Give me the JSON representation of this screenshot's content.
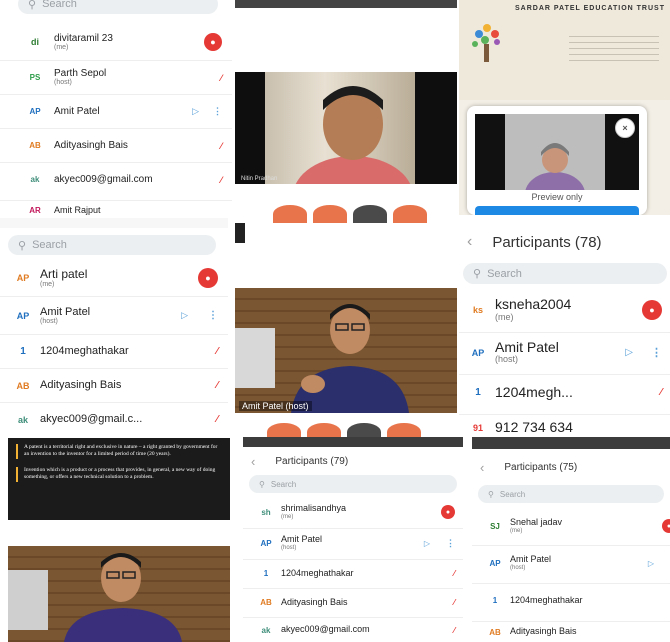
{
  "colors": {
    "accent_red": "#e53935",
    "accent_blue": "#5aa0d8",
    "search_bg": "#eceff1",
    "control_orange": "#e8744b"
  },
  "icons": {
    "search": "search-icon",
    "back": "chevron-left-icon",
    "mic": "mic-icon",
    "camera": "camera-icon",
    "more": "more-icon"
  },
  "t1": {
    "search_placeholder": "Search",
    "rows": [
      {
        "initials": "di",
        "name": "divitaramil 23",
        "sub": "(me)"
      },
      {
        "initials": "PS",
        "name": "Parth Sepol",
        "sub": "(host)"
      },
      {
        "initials": "AP",
        "name": "Amit Patel",
        "sub": ""
      },
      {
        "initials": "AB",
        "name": "Adityasingh Bais",
        "sub": ""
      },
      {
        "initials": "ak",
        "name": "akyec009@gmail.com",
        "sub": ""
      },
      {
        "initials": "AR",
        "name": "Amit Rajput",
        "sub": ""
      }
    ]
  },
  "t2": {
    "video_caption": "Nitin Pradhan"
  },
  "t3": {
    "logo_text": "SARDAR PATEL EDUCATION TRUST",
    "pip_label": "Preview only"
  },
  "t4": {
    "search_placeholder": "Search",
    "rows": [
      {
        "initials": "AP",
        "name": "Arti patel",
        "sub": "(me)"
      },
      {
        "initials": "AP",
        "name": "Amit Patel",
        "sub": "(host)"
      },
      {
        "initials": "1",
        "name": "1204meghathakar",
        "sub": ""
      },
      {
        "initials": "AB",
        "name": "Adityasingh Bais",
        "sub": ""
      },
      {
        "initials": "ak",
        "name": "akyec009@gmail.c...",
        "sub": ""
      }
    ]
  },
  "t5": {
    "video_caption": "Amit Patel (host)"
  },
  "t6": {
    "title": "Participants (78)",
    "search_placeholder": "Search",
    "rows": [
      {
        "initials": "ks",
        "name": "ksneha2004",
        "sub": "(me)"
      },
      {
        "initials": "AP",
        "name": "Amit Patel",
        "sub": "(host)"
      },
      {
        "initials": "1",
        "name": "1204megh...",
        "sub": ""
      },
      {
        "initials": "91",
        "name": "912 734 634",
        "sub": ""
      }
    ]
  },
  "t7": {
    "bullet1": "A patent is a territorial right and exclusive in nature – a right granted by government for an invention to the inventor for a limited period of time (20 years).",
    "bullet2": "Invention which is a product or a process that provides, in general, a new way of doing something, or offers a new technical solution to a problem."
  },
  "t9": {
    "title": "Participants (79)",
    "search_placeholder": "Search",
    "rows": [
      {
        "initials": "sh",
        "name": "shrimalisandhya",
        "sub": "(me)"
      },
      {
        "initials": "AP",
        "name": "Amit Patel",
        "sub": "(host)"
      },
      {
        "initials": "1",
        "name": "1204meghathakar",
        "sub": ""
      },
      {
        "initials": "AB",
        "name": "Adityasingh Bais",
        "sub": ""
      },
      {
        "initials": "ak",
        "name": "akyec009@gmail.com",
        "sub": ""
      }
    ]
  },
  "t10": {
    "title": "Participants (75)",
    "search_placeholder": "Search",
    "rows": [
      {
        "initials": "SJ",
        "name": "Snehal jadav",
        "sub": "(me)"
      },
      {
        "initials": "AP",
        "name": "Amit Patel",
        "sub": "(host)"
      },
      {
        "initials": "1",
        "name": "1204meghathakar",
        "sub": ""
      },
      {
        "initials": "AB",
        "name": "Adityasingh Bais",
        "sub": ""
      }
    ]
  }
}
